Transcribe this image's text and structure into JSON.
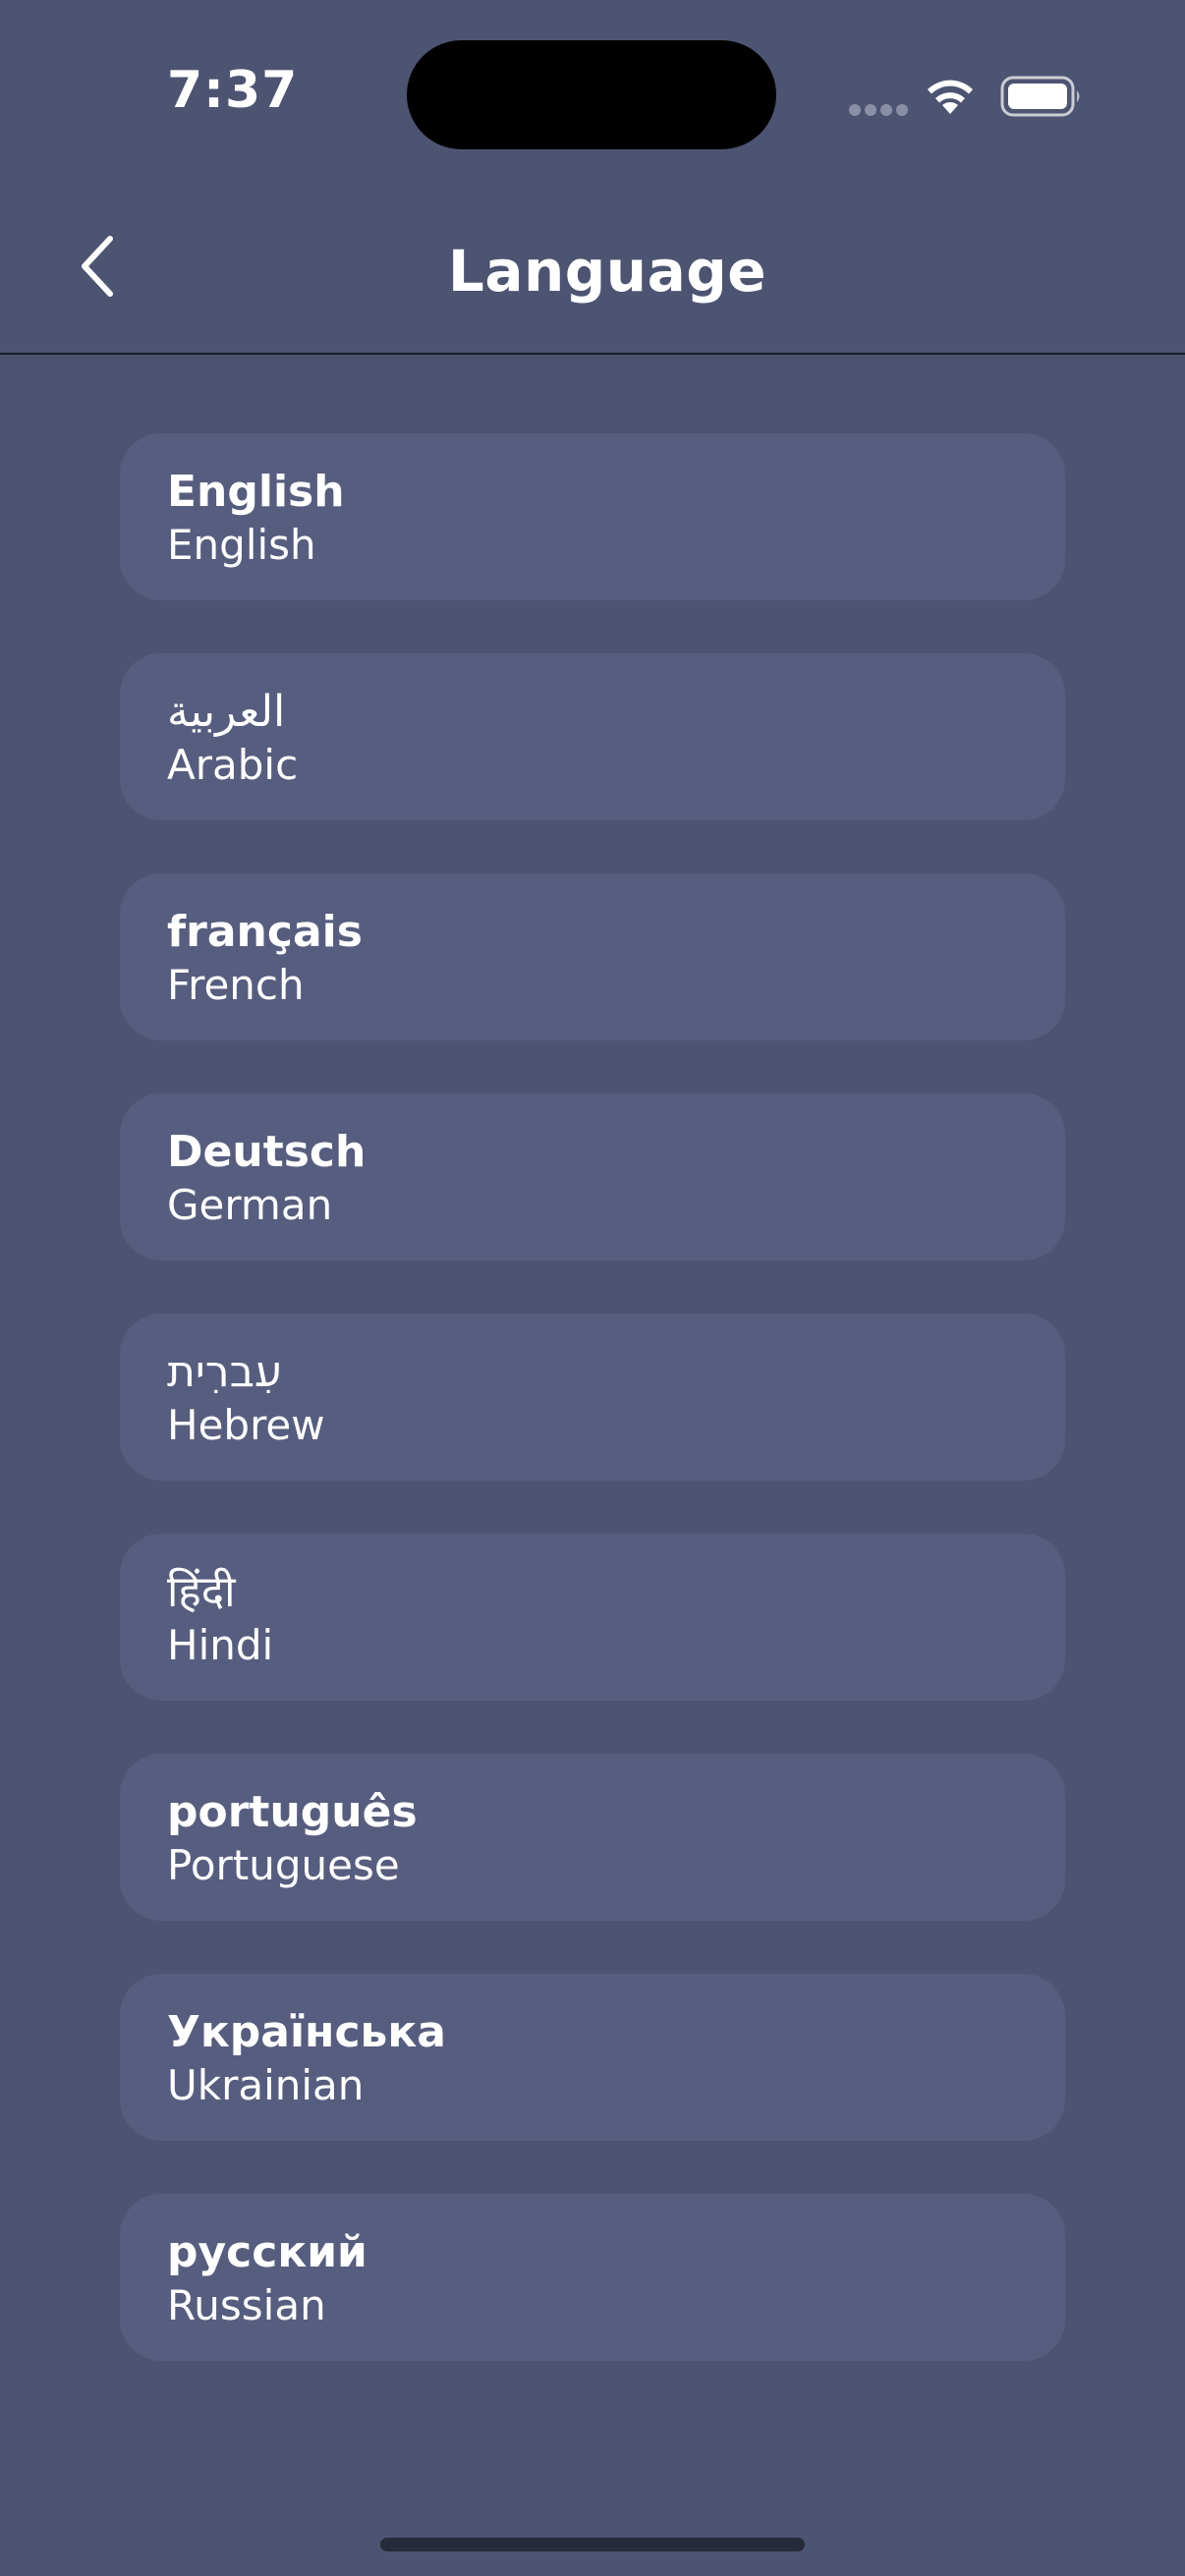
{
  "status_bar": {
    "time": "7:37"
  },
  "header": {
    "title": "Language",
    "back_icon": "chevron-left-icon"
  },
  "languages": [
    {
      "native": "English",
      "english": "English"
    },
    {
      "native": "العربية",
      "english": "Arabic"
    },
    {
      "native": "français",
      "english": "French"
    },
    {
      "native": "Deutsch",
      "english": "German"
    },
    {
      "native": "עִברִית",
      "english": "Hebrew"
    },
    {
      "native": "हिंदी",
      "english": "Hindi"
    },
    {
      "native": "português",
      "english": "Portuguese"
    },
    {
      "native": "Українська",
      "english": "Ukrainian"
    },
    {
      "native": "русский",
      "english": "Russian"
    }
  ],
  "colors": {
    "background": "#4d5472",
    "card": "#575d7e",
    "text": "#ffffff"
  }
}
